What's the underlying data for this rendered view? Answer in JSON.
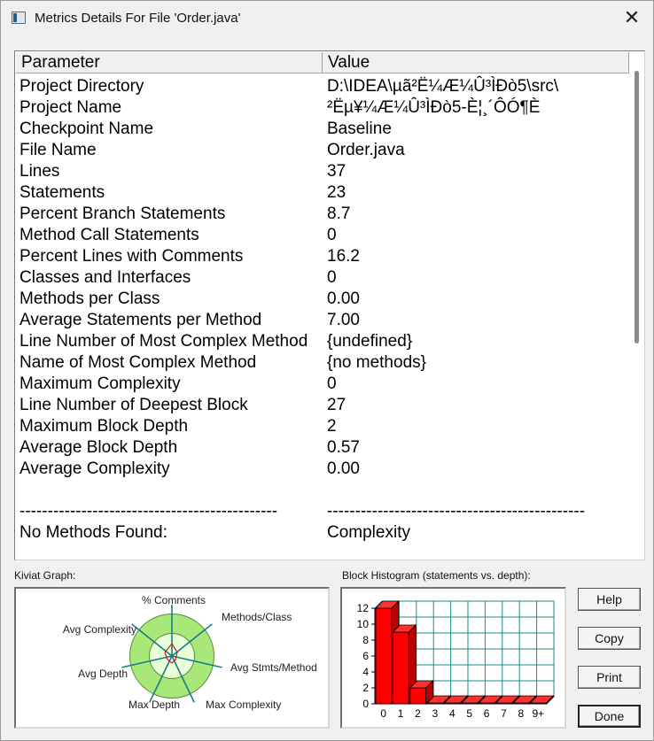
{
  "window": {
    "title": "Metrics Details For File 'Order.java'",
    "close_glyph": "✕"
  },
  "table": {
    "headers": {
      "parameter": "Parameter",
      "value": "Value"
    },
    "rows": [
      {
        "param": "Project Directory",
        "value": "D:\\IDEA\\µã²Ë¼Æ¼Û³ÌÐò5\\src\\"
      },
      {
        "param": "Project Name",
        "value": "²Ëµ¥¼Æ¼Û³ÌÐò5-È¦¸´ÔÓ¶È"
      },
      {
        "param": "Checkpoint Name",
        "value": "Baseline"
      },
      {
        "param": "File Name",
        "value": "Order.java"
      },
      {
        "param": "Lines",
        "value": "37"
      },
      {
        "param": "Statements",
        "value": "23"
      },
      {
        "param": "Percent Branch Statements",
        "value": "8.7"
      },
      {
        "param": "Method Call Statements",
        "value": "0"
      },
      {
        "param": "Percent Lines with Comments",
        "value": "16.2"
      },
      {
        "param": "Classes and Interfaces",
        "value": "0"
      },
      {
        "param": "Methods per Class",
        "value": "0.00"
      },
      {
        "param": "Average Statements per Method",
        "value": "7.00"
      },
      {
        "param": "Line Number of Most Complex Method",
        "value": "{undefined}"
      },
      {
        "param": "Name of Most Complex Method",
        "value": "{no methods}"
      },
      {
        "param": "Maximum Complexity",
        "value": "0"
      },
      {
        "param": "Line Number of Deepest Block",
        "value": "27"
      },
      {
        "param": "Maximum Block Depth",
        "value": "2"
      },
      {
        "param": "Average Block Depth",
        "value": "0.57"
      },
      {
        "param": "Average Complexity",
        "value": "0.00"
      },
      {
        "param": "",
        "value": ""
      },
      {
        "param": "----------------------------------------------",
        "value": "----------------------------------------------"
      },
      {
        "param": "No Methods Found:",
        "value": "Complexity"
      }
    ]
  },
  "kiviat": {
    "label": "Kiviat Graph:",
    "axes": [
      "% Comments",
      "Methods/Class",
      "Avg Stmts/Method",
      "Max Complexity",
      "Max Depth",
      "Avg Depth",
      "Avg Complexity"
    ],
    "colors": {
      "outer_ring": "#a8e878",
      "inner_ring": "#e8ffd8",
      "axis": "#1a7a8a",
      "polygon": "#d01818"
    }
  },
  "histogram": {
    "label": "Block Histogram (statements vs. depth):",
    "y_ticks": [
      "12",
      "10",
      "8",
      "6",
      "4",
      "2",
      "0"
    ],
    "colors": {
      "bar": "#ff0000",
      "grid": "#1a8a8a"
    }
  },
  "chart_data": {
    "type": "bar",
    "title": "Block Histogram (statements vs. depth):",
    "categories": [
      "0",
      "1",
      "2",
      "3",
      "4",
      "5",
      "6",
      "7",
      "8",
      "9+"
    ],
    "values": [
      12,
      9,
      2,
      0,
      0,
      0,
      0,
      0,
      0,
      0
    ],
    "ylim": [
      0,
      12
    ],
    "grid": true
  },
  "buttons": {
    "help": "Help",
    "copy": "Copy",
    "print": "Print",
    "done": "Done"
  }
}
